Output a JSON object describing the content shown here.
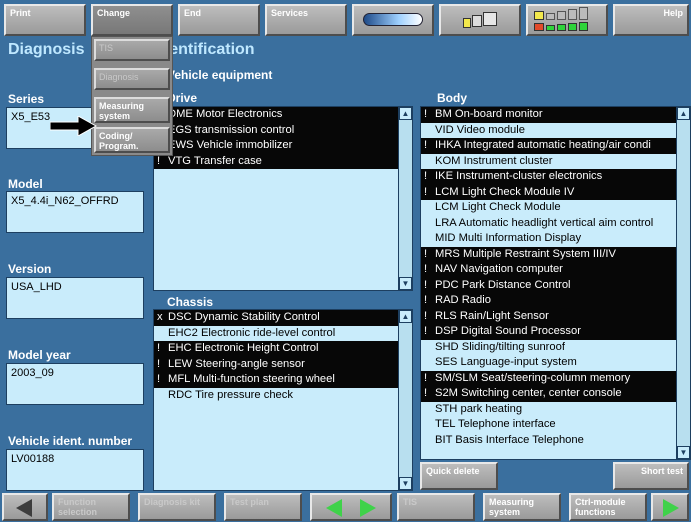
{
  "toolbar": {
    "print": "Print",
    "change": "Change",
    "end": "End",
    "services": "Services",
    "help": "Help"
  },
  "change_menu": {
    "items": [
      "TIS",
      "Diagnosis",
      "Measuring system",
      "Coding/ Program."
    ]
  },
  "titles": {
    "diagnosis": "Diagnosis",
    "identification": "Identification",
    "vehicle_equipment": "Vehicle equipment"
  },
  "left": {
    "series_label": "Series",
    "series_value": "X5_E53",
    "model_label": "Model",
    "model_value": "X5_4.4i_N62_OFFRD",
    "version_label": "Version",
    "version_value": "USA_LHD",
    "model_year_label": "Model year",
    "model_year_value": "2003_09",
    "vin_label": "Vehicle ident. number",
    "vin_value": "LV00188"
  },
  "drive": {
    "label": "Drive",
    "rows": [
      {
        "mark": "",
        "text": "DME Motor Electronics",
        "selected": true
      },
      {
        "mark": "",
        "text": "EGS transmission control",
        "selected": true
      },
      {
        "mark": "",
        "text": "EWS Vehicle immobilizer",
        "selected": true
      },
      {
        "mark": "!",
        "text": "VTG Transfer case",
        "selected": true
      }
    ]
  },
  "chassis": {
    "label": "Chassis",
    "rows": [
      {
        "mark": "x",
        "text": "DSC Dynamic Stability Control",
        "selected": true
      },
      {
        "mark": "",
        "text": "EHC2 Electronic ride-level control",
        "selected": false
      },
      {
        "mark": "!",
        "text": "EHC Electronic Height Control",
        "selected": true
      },
      {
        "mark": "!",
        "text": "LEW Steering-angle sensor",
        "selected": true
      },
      {
        "mark": "!",
        "text": "MFL Multi-function steering wheel",
        "selected": true
      },
      {
        "mark": "",
        "text": "RDC Tire pressure check",
        "selected": false
      }
    ]
  },
  "body_list": {
    "label": "Body",
    "rows": [
      {
        "mark": "!",
        "text": "BM On-board monitor",
        "selected": true
      },
      {
        "mark": "",
        "text": "VID Video module",
        "selected": false
      },
      {
        "mark": "!",
        "text": "IHKA Integrated automatic heating/air condi",
        "selected": true
      },
      {
        "mark": "",
        "text": "KOM Instrument cluster",
        "selected": false
      },
      {
        "mark": "!",
        "text": "IKE Instrument-cluster electronics",
        "selected": true
      },
      {
        "mark": "!",
        "text": "LCM Light Check Module IV",
        "selected": true
      },
      {
        "mark": "",
        "text": "LCM Light Check Module",
        "selected": false
      },
      {
        "mark": "",
        "text": "LRA Automatic headlight vertical aim control",
        "selected": false
      },
      {
        "mark": "",
        "text": "MID Multi Information Display",
        "selected": false
      },
      {
        "mark": "!",
        "text": "MRS Multiple Restraint System III/IV",
        "selected": true
      },
      {
        "mark": "!",
        "text": "NAV Navigation computer",
        "selected": true
      },
      {
        "mark": "!",
        "text": "PDC Park Distance Control",
        "selected": true
      },
      {
        "mark": "!",
        "text": "RAD Radio",
        "selected": true
      },
      {
        "mark": "!",
        "text": "RLS Rain/Light Sensor",
        "selected": true
      },
      {
        "mark": "!",
        "text": "DSP Digital Sound Processor",
        "selected": true
      },
      {
        "mark": "",
        "text": "SHD Sliding/tilting sunroof",
        "selected": false
      },
      {
        "mark": "",
        "text": "SES Language-input system",
        "selected": false
      },
      {
        "mark": "!",
        "text": "SM/SLM Seat/steering-column memory",
        "selected": true
      },
      {
        "mark": "!",
        "text": "S2M Switching center, center console",
        "selected": true
      },
      {
        "mark": "",
        "text": "STH park heating",
        "selected": false
      },
      {
        "mark": "",
        "text": "TEL Telephone interface",
        "selected": false
      },
      {
        "mark": "",
        "text": "BIT Basis Interface Telephone",
        "selected": false
      }
    ]
  },
  "actions": {
    "quick_delete": "Quick delete",
    "short_test": "Short test"
  },
  "bottom": {
    "function_selection": "Function selection",
    "diagnosis_kit": "Diagnosis kit",
    "test_plan": "Test plan",
    "tis": "TIS",
    "measuring_system": "Measuring system",
    "ctrl_module_functions": "Ctrl-module functions"
  },
  "icons": {
    "arrow_pointer": "arrow-right-icon",
    "battery": "battery-icon",
    "network": "network-icon",
    "signal_bars": "signal-bars-icon"
  }
}
